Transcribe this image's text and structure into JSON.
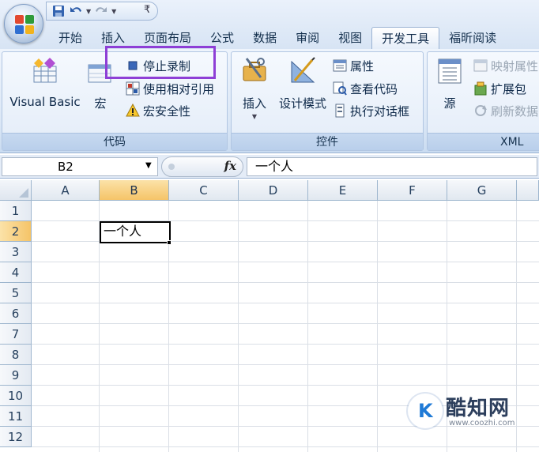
{
  "quick_access": {
    "save_icon": "save-icon",
    "undo_icon": "undo-icon",
    "redo_icon": "redo-icon",
    "customize_label": "₹"
  },
  "tabs": [
    {
      "label": "开始"
    },
    {
      "label": "插入"
    },
    {
      "label": "页面布局"
    },
    {
      "label": "公式"
    },
    {
      "label": "数据"
    },
    {
      "label": "审阅"
    },
    {
      "label": "视图"
    },
    {
      "label": "开发工具",
      "active": true
    },
    {
      "label": "福昕阅读"
    }
  ],
  "ribbon": {
    "code": {
      "label": "代码",
      "visual_basic": "Visual Basic",
      "macros": "宏",
      "stop_recording": "停止录制",
      "use_relative_refs": "使用相对引用",
      "macro_security": "宏安全性"
    },
    "controls": {
      "label": "控件",
      "insert": "插入",
      "design_mode": "设计模式",
      "properties": "属性",
      "view_code": "查看代码",
      "run_dialog": "执行对话框"
    },
    "xml": {
      "label": "XML",
      "source": "源",
      "map_properties": "映射属性",
      "expansion_packs": "扩展包",
      "refresh_data": "刷新数据"
    }
  },
  "formula_bar": {
    "name_box": "B2",
    "fx_label": "fx",
    "value": "一个人"
  },
  "sheet": {
    "columns": [
      "A",
      "B",
      "C",
      "D",
      "E",
      "F",
      "G"
    ],
    "rows": [
      "1",
      "2",
      "3",
      "4",
      "5",
      "6",
      "7",
      "8",
      "9",
      "10",
      "11",
      "12"
    ],
    "selected_column": "B",
    "selected_row": "2",
    "active_cell_value": "一个人"
  },
  "watermark": {
    "title": "酷知网",
    "url": "www.coozhi.com"
  },
  "colors": {
    "highlight_box": "#8e3fd6",
    "selected_header": "#f5c468",
    "ribbon_bg": "#dbe7f6"
  }
}
